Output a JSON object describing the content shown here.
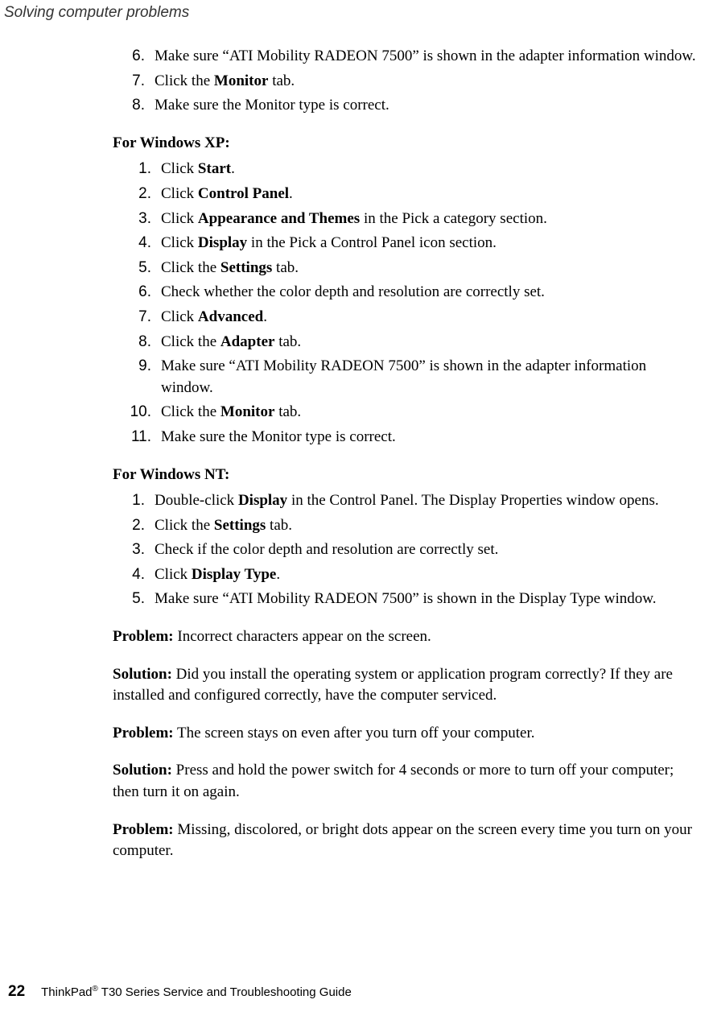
{
  "runningHead": "Solving computer problems",
  "topList": [
    {
      "n": "6.",
      "pre": "Make sure “ATI Mobility RADEON 7500” is shown in the adapter information window."
    },
    {
      "n": "7.",
      "pre": "Click the ",
      "b": "Monitor",
      "post": " tab."
    },
    {
      "n": "8.",
      "pre": "Make sure the Monitor type is correct."
    }
  ],
  "xpHead": "For Windows XP:",
  "xpList": [
    {
      "n": "1.",
      "pre": "Click ",
      "b": "Start",
      "post": "."
    },
    {
      "n": "2.",
      "pre": "Click ",
      "b": "Control Panel",
      "post": "."
    },
    {
      "n": "3.",
      "pre": "Click ",
      "b": "Appearance and Themes",
      "post": " in the Pick a category section."
    },
    {
      "n": "4.",
      "pre": "Click ",
      "b": "Display",
      "post": " in the Pick a Control Panel icon section."
    },
    {
      "n": "5.",
      "pre": "Click the ",
      "b": "Settings",
      "post": " tab."
    },
    {
      "n": "6.",
      "pre": "Check whether the color depth and resolution are correctly set."
    },
    {
      "n": "7.",
      "pre": "Click ",
      "b": "Advanced",
      "post": "."
    },
    {
      "n": "8.",
      "pre": "Click the ",
      "b": "Adapter",
      "post": " tab."
    },
    {
      "n": "9.",
      "pre": "Make sure “ATI Mobility RADEON 7500” is shown in the adapter information window."
    },
    {
      "n": "10.",
      "pre": "Click the ",
      "b": "Monitor",
      "post": " tab."
    },
    {
      "n": "11.",
      "pre": "Make sure the Monitor type is correct."
    }
  ],
  "ntHead": "For Windows NT:",
  "ntList": [
    {
      "n": "1.",
      "pre": "Double-click ",
      "b": "Display",
      "post": " in the Control Panel. The Display Properties window opens."
    },
    {
      "n": "2.",
      "pre": "Click the ",
      "b": "Settings",
      "post": " tab."
    },
    {
      "n": "3.",
      "pre": "Check if the color depth and resolution are correctly set."
    },
    {
      "n": "4.",
      "pre": "Click ",
      "b": "Display Type",
      "post": "."
    },
    {
      "n": "5.",
      "pre": "Make sure “ATI Mobility RADEON 7500” is shown in the Display Type window."
    }
  ],
  "paras": [
    {
      "label": "Problem:",
      "text": " Incorrect characters appear on the screen."
    },
    {
      "label": "Solution:",
      "text": " Did you install the operating system or application program correctly? If they are installed and configured correctly, have the computer serviced."
    },
    {
      "label": "Problem:",
      "text": " The screen stays on even after you turn off your computer."
    },
    {
      "label": "Solution:",
      "text": " Press and hold the power switch for 4 seconds or more to turn off your computer; then turn it on again."
    },
    {
      "label": "Problem:",
      "text": " Missing, discolored, or bright dots appear on the screen every time you turn on your computer."
    }
  ],
  "pageNumber": "22",
  "footerPre": "ThinkPad",
  "footerReg": "®",
  "footerPost": " T30 Series Service and Troubleshooting Guide"
}
